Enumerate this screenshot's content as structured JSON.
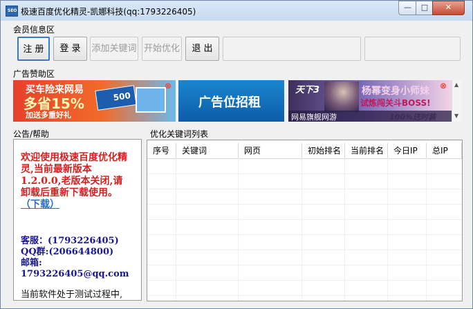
{
  "window": {
    "title": "极速百度优化精灵-凯娜科技(qq:1793226405)",
    "minimize": "—",
    "maximize": "□",
    "close": "✕",
    "icon_label": "SEO"
  },
  "member": {
    "group_label": "会员信息区",
    "register": "注 册",
    "login": "登 录",
    "add_keyword": "添加关键词",
    "start": "开始优化",
    "exit": "退 出"
  },
  "ads": {
    "group_label": "广告赞助区",
    "ad1_line1": "买车险来网易",
    "ad1_line2": "多省15%",
    "ad1_line3": "加送多重好礼",
    "ad1_badge": "500",
    "ad2": "广告位招租",
    "ad3_logo": "天下3",
    "ad3_line1": "杨幂变身小师妹",
    "ad3_line2": "试炼闯关斗BOSS!",
    "ad3_line3": "网易旗舰网游",
    "ad3_line4": "100%送时装"
  },
  "notice": {
    "group_label": "公告/帮助",
    "message": "欢迎使用极速百度优化精灵,当前最新版本1.2.0.0,老版本关闭,请卸载后重新下载使用。",
    "download_link": "（下载）",
    "service": "客服：(1793226405)",
    "qq_group": "QQ群:(206644800)",
    "email_label": "邮箱:",
    "email": "1793226405@qq.com",
    "footer": "当前软件处于测试过程中,"
  },
  "table": {
    "group_label": "优化关键词列表",
    "columns": [
      "序号",
      "关键词",
      "网页",
      "初始排名",
      "当前排名",
      "今日IP",
      "总IP"
    ]
  }
}
